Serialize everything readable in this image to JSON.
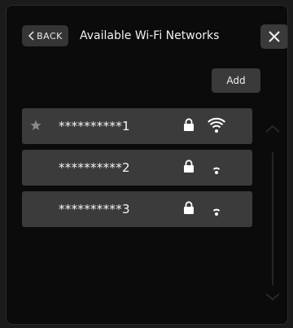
{
  "header": {
    "back_label": "BACK",
    "title": "Available Wi-Fi Networks"
  },
  "actions": {
    "add_label": "Add"
  },
  "networks": [
    {
      "name": "**********1",
      "favorite": true,
      "secured": true,
      "signal_bars": 3
    },
    {
      "name": "**********2",
      "favorite": false,
      "secured": true,
      "signal_bars": 1
    },
    {
      "name": "**********3",
      "favorite": false,
      "secured": true,
      "signal_bars": 1
    }
  ],
  "icons": {
    "back": "chevron-left-icon",
    "close": "close-icon",
    "favorite": "star-icon",
    "secured": "lock-icon",
    "signal": "wifi-icon",
    "scroll_up": "chevron-up-icon",
    "scroll_down": "chevron-down-icon"
  },
  "colors": {
    "background": "#0b0b0b",
    "button": "#3a3a3a",
    "row": "#3b3b3b",
    "text": "#ffffff",
    "muted": "#8a8a8a"
  }
}
